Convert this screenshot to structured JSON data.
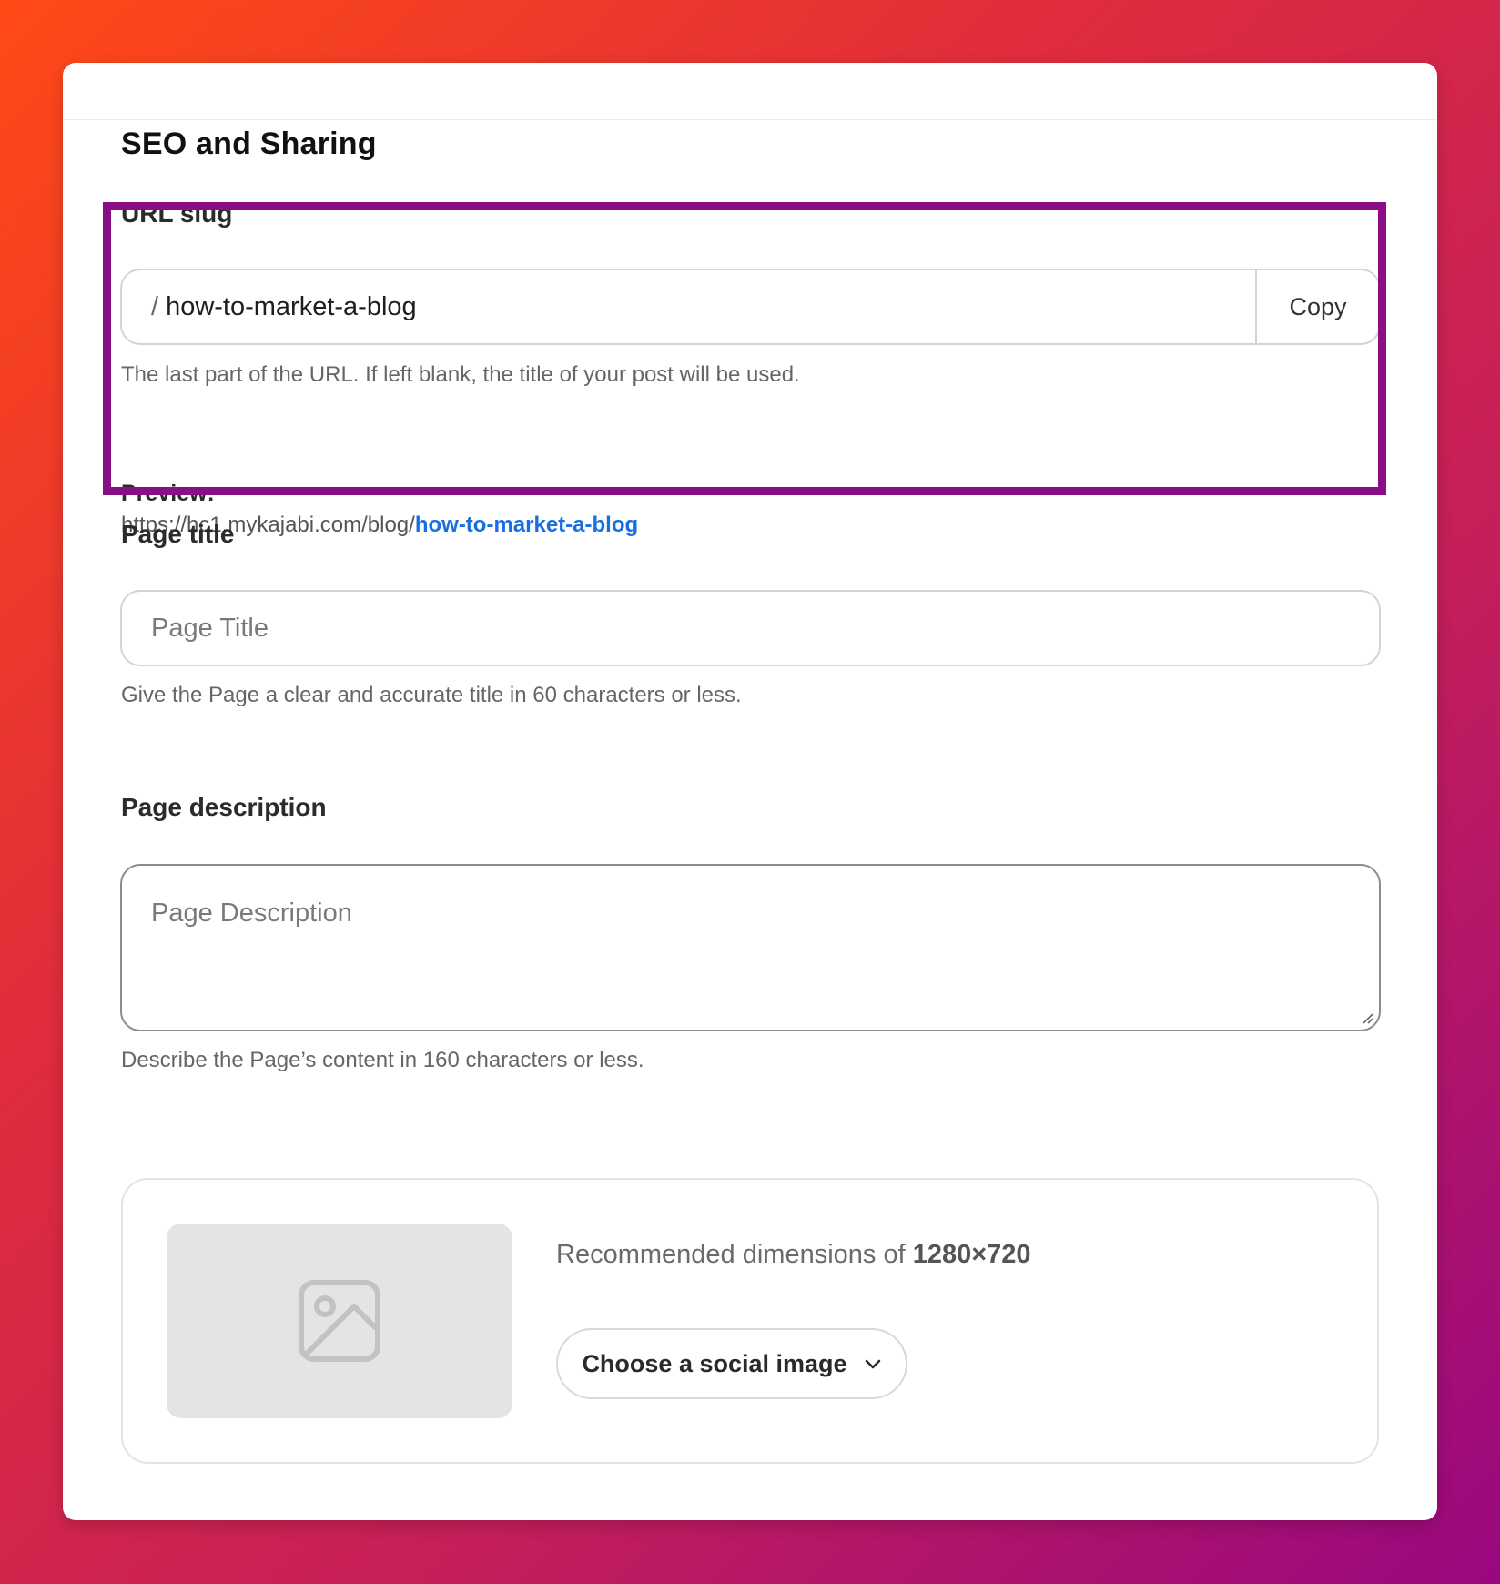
{
  "section": {
    "title": "SEO and Sharing"
  },
  "url_slug": {
    "label": "URL slug",
    "prefix": "/",
    "value": "how-to-market-a-blog",
    "copy_label": "Copy",
    "help": "The last part of the URL. If left blank, the title of your post will be used.",
    "preview_label": "Preview:",
    "preview_base": "https://hc1.mykajabi.com/blog/",
    "preview_slug": "how-to-market-a-blog"
  },
  "page_title": {
    "label": "Page title",
    "placeholder": "Page Title",
    "value": "",
    "help": "Give the Page a clear and accurate title in 60 characters or less."
  },
  "page_description": {
    "label": "Page description",
    "placeholder": "Page Description",
    "value": "",
    "help": "Describe the Page’s content in 160 characters or less."
  },
  "social_image": {
    "recommend_text": "Recommended dimensions of ",
    "recommend_dims": "1280×720",
    "choose_label": "Choose a social image",
    "placeholder_icon": "image-icon",
    "dropdown_icon": "chevron-down-icon"
  },
  "colors": {
    "highlight_border": "#8a0e88",
    "link": "#1a6fe0",
    "background_start": "#ff4a16",
    "background_end": "#98087f"
  }
}
